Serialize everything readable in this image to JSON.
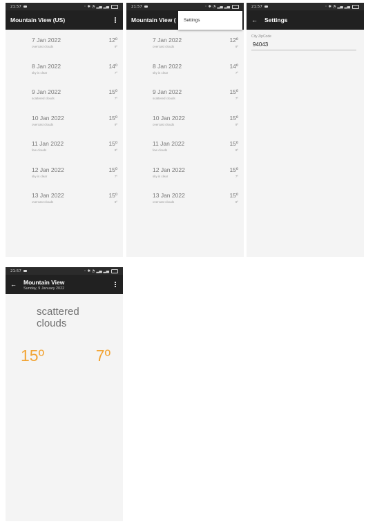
{
  "status_bar": {
    "time": "21:57",
    "indicators": "☉ ✱ ⊹ ࿅ ⁙ .⁙"
  },
  "icons": {
    "overflow": "more-vertical-icon",
    "back": "arrow-left-icon",
    "battery": "battery-icon"
  },
  "forecast_screen": {
    "title": "Mountain View (US)",
    "days": [
      {
        "date": "7 Jan 2022",
        "desc": "overcast clouds",
        "hi": "12º",
        "lo": "9º"
      },
      {
        "date": "8 Jan 2022",
        "desc": "sky is clear",
        "hi": "14º",
        "lo": "7º"
      },
      {
        "date": "9 Jan 2022",
        "desc": "scattered clouds",
        "hi": "15º",
        "lo": "7º"
      },
      {
        "date": "10 Jan 2022",
        "desc": "overcast clouds",
        "hi": "15º",
        "lo": "9º"
      },
      {
        "date": "11 Jan 2022",
        "desc": "few clouds",
        "hi": "15º",
        "lo": "8º"
      },
      {
        "date": "12 Jan 2022",
        "desc": "sky is clear",
        "hi": "15º",
        "lo": "7º"
      },
      {
        "date": "13 Jan 2022",
        "desc": "overcast clouds",
        "hi": "15º",
        "lo": "8º"
      }
    ]
  },
  "menu_screen": {
    "title": "Mountain View (",
    "menu_item": "Settings"
  },
  "settings_screen": {
    "title": "Settings",
    "field_label": "City ZipCode",
    "field_value": "94043"
  },
  "detail_screen": {
    "title": "Mountain View",
    "subtitle": "Sunday, 9 January 2022",
    "desc_line1": "scattered",
    "desc_line2": "clouds",
    "hi": "15º",
    "lo": "7º",
    "temp_color": "#f2a434"
  }
}
